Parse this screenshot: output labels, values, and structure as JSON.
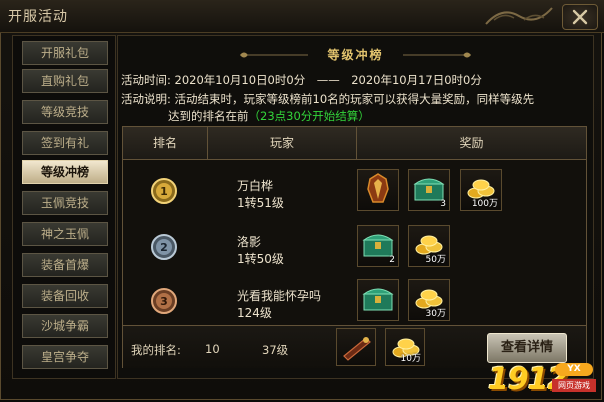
{
  "window": {
    "title": "开服活动",
    "close_icon": "close-icon"
  },
  "sidebar": {
    "items": [
      {
        "label": "开服礼包"
      },
      {
        "label": "直购礼包"
      },
      {
        "label": "等级竞技"
      },
      {
        "label": "签到有礼"
      },
      {
        "label": "等级冲榜",
        "active": true
      },
      {
        "label": "玉佩竞技"
      },
      {
        "label": "神之玉佩"
      },
      {
        "label": "装备首爆"
      },
      {
        "label": "装备回收"
      },
      {
        "label": "沙城争霸"
      },
      {
        "label": "皇宫争夺"
      }
    ]
  },
  "main": {
    "banner": "等级冲榜",
    "time_line": "活动时间: 2020年10月10日0时0分　——　2020年10月17日0时0分",
    "desc_line1": "活动说明: 活动结束时，玩家等级榜前10名的玩家可以获得大量奖励，同样等级先",
    "desc_line2_prefix": "达到的排名在前",
    "desc_line2_green": "（23点30分开始结算）",
    "table": {
      "headers": {
        "rank": "排名",
        "player": "玩家",
        "reward": "奖励"
      },
      "rows": [
        {
          "rank_icon": "gold-medal-1-icon",
          "name": "万白桦",
          "level": "1转51级",
          "rewards": [
            {
              "icon": "armor-icon",
              "qty": ""
            },
            {
              "icon": "jade-chest-icon",
              "qty": "3"
            },
            {
              "icon": "gold-coins-icon",
              "qty": "100万"
            }
          ]
        },
        {
          "rank_icon": "silver-medal-2-icon",
          "name": "洛影",
          "level": "1转50级",
          "rewards": [
            {
              "icon": "jade-chest-icon",
              "qty": "2"
            },
            {
              "icon": "gold-coins-icon",
              "qty": "50万"
            }
          ]
        },
        {
          "rank_icon": "bronze-medal-3-icon",
          "name": "光看我能怀孕吗",
          "level": "124级",
          "rewards": [
            {
              "icon": "jade-chest-icon",
              "qty": ""
            },
            {
              "icon": "gold-coins-icon",
              "qty": "30万"
            }
          ]
        }
      ],
      "footer": {
        "my_rank_label": "我的排名:",
        "my_rank_value": "10",
        "my_level": "37级",
        "rewards": [
          {
            "icon": "ring-icon",
            "qty": ""
          },
          {
            "icon": "gold-coins-icon",
            "qty": "10万"
          }
        ],
        "detail_button": "查看详情"
      }
    }
  },
  "watermark": {
    "number": "1912",
    "badge": "YX",
    "sub": "网页游戏"
  }
}
